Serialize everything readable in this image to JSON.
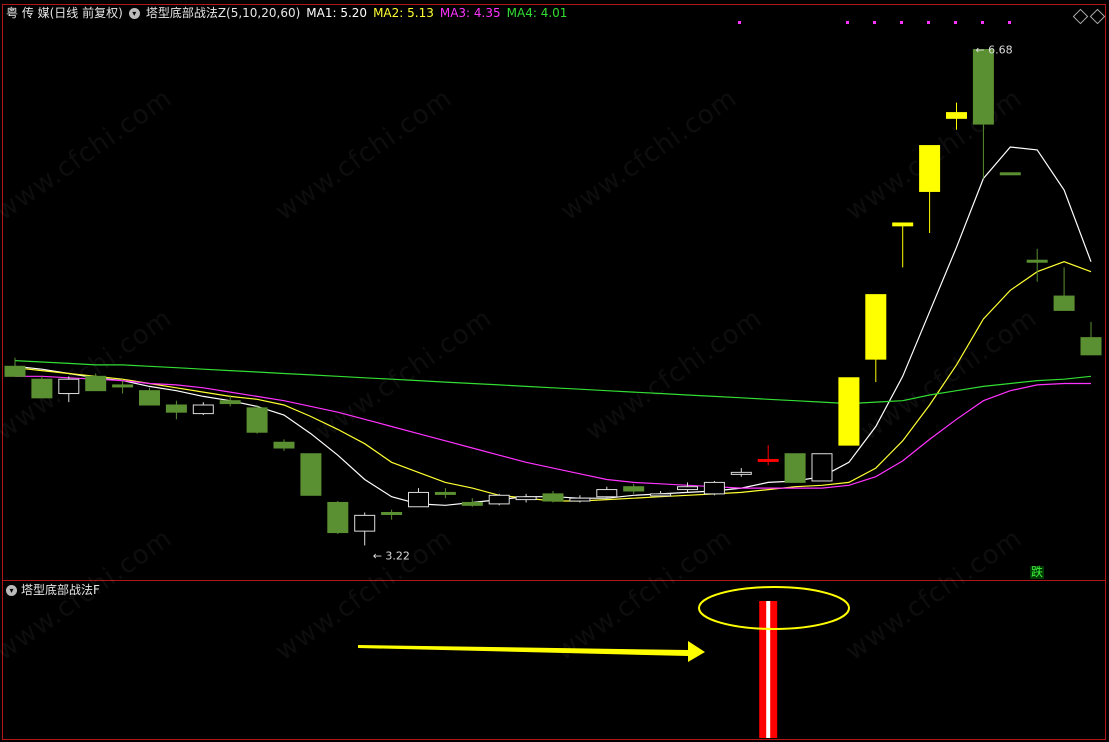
{
  "header": {
    "symbol": "粤 传 媒(日线 前复权)",
    "indicator": "塔型底部战法Z(5,10,20,60)",
    "ma1_label": "MA1: 5.20",
    "ma2_label": "MA2: 5.13",
    "ma3_label": "MA3: 4.35",
    "ma4_label": "MA4: 4.01"
  },
  "sub_panel": {
    "title": "塔型底部战法F"
  },
  "annotations": {
    "high": "6.68",
    "low": "3.22",
    "fall_badge": "跌"
  },
  "watermark": "www.cfchi.com",
  "colors": {
    "frame": "#b01818",
    "ma1": "#ffffff",
    "ma2": "#ffff33",
    "ma3": "#ff33ff",
    "ma4": "#33dd33",
    "up_candle": "#ffff00",
    "down_candle": "#5a8f32",
    "signal": "#ff0000",
    "arrow": "#ffff00"
  },
  "chart_data": {
    "type": "candlestick",
    "price_range": [
      3.0,
      6.9
    ],
    "candles": [
      {
        "o": 4.47,
        "h": 4.53,
        "l": 4.4,
        "c": 4.4,
        "dir": "down"
      },
      {
        "o": 4.38,
        "h": 4.4,
        "l": 4.25,
        "c": 4.25,
        "dir": "down"
      },
      {
        "o": 4.28,
        "h": 4.4,
        "l": 4.22,
        "c": 4.38,
        "dir": "hollow"
      },
      {
        "o": 4.4,
        "h": 4.42,
        "l": 4.3,
        "c": 4.3,
        "dir": "down"
      },
      {
        "o": 4.34,
        "h": 4.37,
        "l": 4.28,
        "c": 4.33,
        "dir": "down"
      },
      {
        "o": 4.3,
        "h": 4.32,
        "l": 4.2,
        "c": 4.2,
        "dir": "down"
      },
      {
        "o": 4.2,
        "h": 4.23,
        "l": 4.1,
        "c": 4.15,
        "dir": "down"
      },
      {
        "o": 4.14,
        "h": 4.22,
        "l": 4.13,
        "c": 4.2,
        "dir": "hollow"
      },
      {
        "o": 4.23,
        "h": 4.27,
        "l": 4.19,
        "c": 4.21,
        "dir": "down"
      },
      {
        "o": 4.18,
        "h": 4.2,
        "l": 4.0,
        "c": 4.01,
        "dir": "down"
      },
      {
        "o": 3.94,
        "h": 3.96,
        "l": 3.88,
        "c": 3.9,
        "dir": "down"
      },
      {
        "o": 3.86,
        "h": 3.86,
        "l": 3.57,
        "c": 3.57,
        "dir": "down"
      },
      {
        "o": 3.52,
        "h": 3.53,
        "l": 3.3,
        "c": 3.31,
        "dir": "down"
      },
      {
        "o": 3.32,
        "h": 3.45,
        "l": 3.22,
        "c": 3.43,
        "dir": "hollow"
      },
      {
        "o": 3.44,
        "h": 3.47,
        "l": 3.4,
        "c": 3.45,
        "dir": "down"
      },
      {
        "o": 3.49,
        "h": 3.62,
        "l": 3.49,
        "c": 3.59,
        "dir": "hollow"
      },
      {
        "o": 3.59,
        "h": 3.62,
        "l": 3.55,
        "c": 3.58,
        "dir": "down"
      },
      {
        "o": 3.52,
        "h": 3.55,
        "l": 3.49,
        "c": 3.5,
        "dir": "down"
      },
      {
        "o": 3.51,
        "h": 3.58,
        "l": 3.5,
        "c": 3.57,
        "dir": "hollow"
      },
      {
        "o": 3.54,
        "h": 3.58,
        "l": 3.52,
        "c": 3.56,
        "dir": "hollow"
      },
      {
        "o": 3.58,
        "h": 3.6,
        "l": 3.52,
        "c": 3.53,
        "dir": "down"
      },
      {
        "o": 3.53,
        "h": 3.57,
        "l": 3.52,
        "c": 3.55,
        "dir": "hollow"
      },
      {
        "o": 3.56,
        "h": 3.63,
        "l": 3.55,
        "c": 3.61,
        "dir": "hollow"
      },
      {
        "o": 3.63,
        "h": 3.65,
        "l": 3.58,
        "c": 3.6,
        "dir": "down"
      },
      {
        "o": 3.58,
        "h": 3.6,
        "l": 3.56,
        "c": 3.58,
        "dir": "hollow"
      },
      {
        "o": 3.61,
        "h": 3.66,
        "l": 3.59,
        "c": 3.63,
        "dir": "hollow"
      },
      {
        "o": 3.58,
        "h": 3.67,
        "l": 3.57,
        "c": 3.66,
        "dir": "hollow"
      },
      {
        "o": 3.72,
        "h": 3.76,
        "l": 3.7,
        "c": 3.73,
        "dir": "hollow"
      },
      {
        "o": 3.82,
        "h": 3.92,
        "l": 3.78,
        "c": 3.82,
        "dir": "signal"
      },
      {
        "o": 3.86,
        "h": 3.86,
        "l": 3.66,
        "c": 3.66,
        "dir": "down"
      },
      {
        "o": 3.67,
        "h": 3.86,
        "l": 3.67,
        "c": 3.86,
        "dir": "hollow"
      },
      {
        "o": 3.92,
        "h": 4.39,
        "l": 3.92,
        "c": 4.39,
        "dir": "up"
      },
      {
        "o": 4.52,
        "h": 4.97,
        "l": 4.36,
        "c": 4.97,
        "dir": "up"
      },
      {
        "o": 5.47,
        "h": 5.47,
        "l": 5.16,
        "c": 5.45,
        "dir": "up"
      },
      {
        "o": 6.01,
        "h": 6.01,
        "l": 5.4,
        "c": 5.69,
        "dir": "up"
      },
      {
        "o": 6.24,
        "h": 6.31,
        "l": 6.12,
        "c": 6.2,
        "dir": "up"
      },
      {
        "o": 6.68,
        "h": 6.68,
        "l": 5.78,
        "c": 6.16,
        "dir": "down"
      },
      {
        "o": 5.82,
        "h": 5.82,
        "l": 5.82,
        "c": 5.82,
        "dir": "down"
      },
      {
        "o": 5.21,
        "h": 5.29,
        "l": 5.06,
        "c": 5.21,
        "dir": "down"
      },
      {
        "o": 4.96,
        "h": 5.16,
        "l": 4.86,
        "c": 4.86,
        "dir": "down"
      },
      {
        "o": 4.67,
        "h": 4.78,
        "l": 4.55,
        "c": 4.55,
        "dir": "down"
      }
    ],
    "series": [
      {
        "name": "MA1",
        "values": [
          4.47,
          4.45,
          4.42,
          4.39,
          4.37,
          4.33,
          4.3,
          4.26,
          4.23,
          4.19,
          4.13,
          4.0,
          3.85,
          3.68,
          3.56,
          3.51,
          3.5,
          3.52,
          3.54,
          3.56,
          3.56,
          3.55,
          3.55,
          3.57,
          3.58,
          3.59,
          3.6,
          3.62,
          3.66,
          3.67,
          3.7,
          3.8,
          4.05,
          4.4,
          4.85,
          5.3,
          5.78,
          6.0,
          5.98,
          5.7,
          5.2
        ]
      },
      {
        "name": "MA2",
        "values": [
          4.46,
          4.44,
          4.42,
          4.4,
          4.38,
          4.35,
          4.32,
          4.29,
          4.26,
          4.24,
          4.2,
          4.12,
          4.03,
          3.93,
          3.8,
          3.73,
          3.66,
          3.62,
          3.57,
          3.55,
          3.53,
          3.53,
          3.54,
          3.55,
          3.56,
          3.57,
          3.58,
          3.59,
          3.61,
          3.63,
          3.64,
          3.66,
          3.76,
          3.95,
          4.2,
          4.48,
          4.8,
          5.0,
          5.13,
          5.2,
          5.13
        ]
      },
      {
        "name": "MA3",
        "values": [
          4.4,
          4.4,
          4.39,
          4.38,
          4.37,
          4.35,
          4.34,
          4.32,
          4.29,
          4.26,
          4.23,
          4.19,
          4.15,
          4.1,
          4.05,
          4.0,
          3.95,
          3.9,
          3.85,
          3.8,
          3.76,
          3.72,
          3.68,
          3.66,
          3.65,
          3.64,
          3.63,
          3.62,
          3.62,
          3.62,
          3.62,
          3.64,
          3.7,
          3.81,
          3.96,
          4.1,
          4.23,
          4.3,
          4.34,
          4.35,
          4.35
        ]
      },
      {
        "name": "MA4",
        "values": [
          4.51,
          4.5,
          4.49,
          4.48,
          4.48,
          4.47,
          4.46,
          4.45,
          4.44,
          4.43,
          4.42,
          4.41,
          4.4,
          4.39,
          4.38,
          4.37,
          4.36,
          4.35,
          4.34,
          4.33,
          4.32,
          4.31,
          4.3,
          4.29,
          4.28,
          4.27,
          4.26,
          4.25,
          4.24,
          4.23,
          4.22,
          4.21,
          4.22,
          4.23,
          4.27,
          4.3,
          4.33,
          4.35,
          4.37,
          4.38,
          4.4
        ]
      }
    ],
    "signal_index": 28,
    "sub_panel_signal": true
  }
}
